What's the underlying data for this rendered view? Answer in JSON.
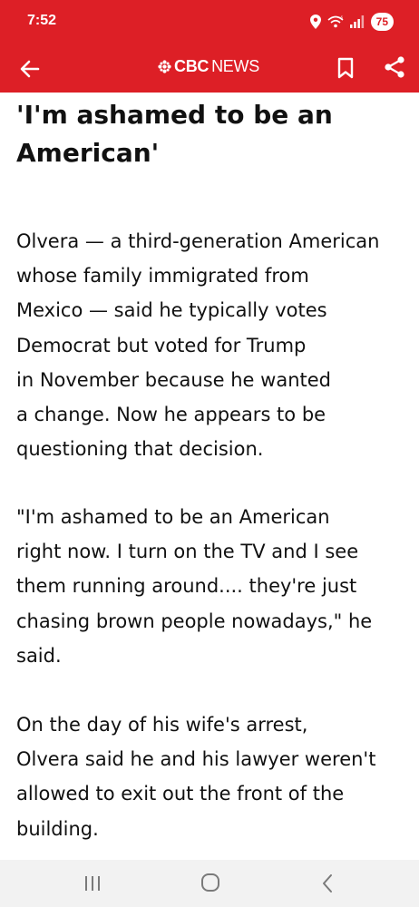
{
  "status": {
    "time": "7:52",
    "battery": "75",
    "icons": [
      "location-icon",
      "wifi-icon",
      "signal-icon",
      "battery-icon"
    ]
  },
  "app_bar": {
    "logo_cbc": "CBC",
    "logo_news": "NEWS",
    "background": "#dd1f26",
    "icons": [
      "back-arrow-icon",
      "bookmark-icon",
      "share-icon"
    ]
  },
  "article": {
    "headline_lines": [
      "'I'm ashamed to be an",
      "American'"
    ],
    "paragraphs": [
      {
        "lines": [
          "Olvera — a third-generation American",
          "whose family immigrated from",
          "Mexico — said he typically votes",
          "Democrat but voted for Trump",
          "in November because he wanted",
          "a change. Now he appears to be",
          "questioning that decision."
        ]
      },
      {
        "lines": [
          "\"I'm ashamed to be an American",
          "right now. I turn on the TV and I see",
          "them running around.... they're just",
          "chasing brown people nowadays,\" he",
          "said."
        ]
      },
      {
        "lines": [
          "On the day of his wife's arrest,",
          "Olvera said he and his lawyer weren't",
          "allowed to exit out the front of the",
          "building."
        ]
      }
    ]
  },
  "nav_bar": {
    "icons": [
      "recent-apps-icon",
      "home-icon",
      "system-back-icon"
    ]
  }
}
